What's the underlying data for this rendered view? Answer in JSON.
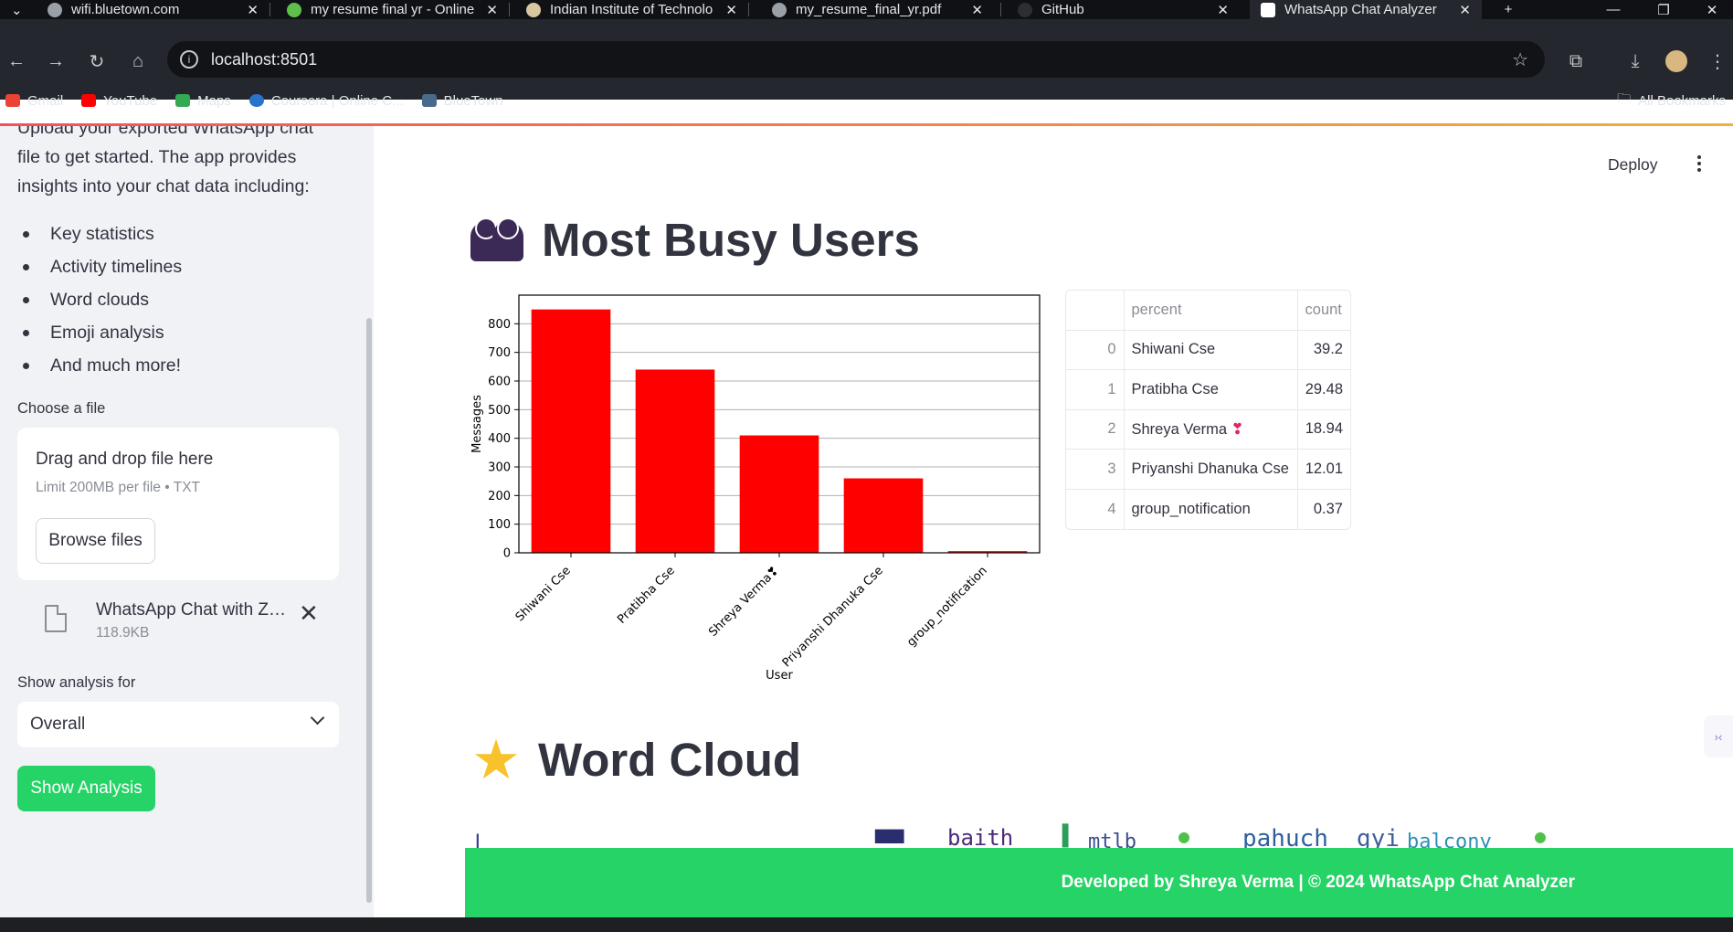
{
  "browser": {
    "tabs": [
      {
        "title": "wifi.bluetown.com",
        "active": false
      },
      {
        "title": "my resume final yr - Online",
        "active": false
      },
      {
        "title": "Indian Institute of Technolo",
        "active": false
      },
      {
        "title": "my_resume_final_yr.pdf",
        "active": false
      },
      {
        "title": "GitHub",
        "active": false
      },
      {
        "title": "WhatsApp Chat Analyzer",
        "active": true
      }
    ],
    "url": "localhost:8501",
    "bookmarks": [
      "Gmail",
      "YouTube",
      "Maps",
      "Coursera | Online C...",
      "BlueTown"
    ],
    "all_bookmarks": "All Bookmarks"
  },
  "sidebar": {
    "intro": "Upload your exported WhatsApp chat file to get started. The app provides insights into your chat data including:",
    "features": [
      "Key statistics",
      "Activity timelines",
      "Word clouds",
      "Emoji analysis",
      "And much more!"
    ],
    "file_label": "Choose a file",
    "dropzone_title": "Drag and drop file here",
    "dropzone_limit": "Limit 200MB per file • TXT",
    "browse_label": "Browse files",
    "uploaded_file_name": "WhatsApp Chat with Zo...",
    "uploaded_file_size": "118.9KB",
    "analysis_label": "Show analysis for",
    "analysis_selected": "Overall",
    "show_button": "Show Analysis"
  },
  "header": {
    "deploy": "Deploy"
  },
  "sections": {
    "busy_users_title": "Most Busy Users",
    "word_cloud_title": "Word Cloud"
  },
  "chart_data": {
    "type": "bar",
    "categories": [
      "Shiwani Cse",
      "Pratibha Cse",
      "Shreya Verma❣",
      "Priyanshi Dhanuka Cse",
      "group_notification"
    ],
    "values": [
      850,
      640,
      410,
      260,
      6
    ],
    "xlabel": "User",
    "ylabel": "Messages",
    "ylim": [
      0,
      900
    ],
    "yticks": [
      0,
      100,
      200,
      300,
      400,
      500,
      600,
      700,
      800
    ],
    "bar_color": "#ff0000",
    "grid": true
  },
  "table": {
    "columns": [
      "",
      "percent",
      "count"
    ],
    "rows": [
      {
        "index": "0",
        "name": "Shiwani Cse",
        "value": "39.2"
      },
      {
        "index": "1",
        "name": "Pratibha Cse",
        "value": "29.48"
      },
      {
        "index": "2",
        "name": "Shreya Verma",
        "heart": "❣",
        "value": "18.94"
      },
      {
        "index": "3",
        "name": "Priyanshi Dhanuka Cse",
        "value": "12.01"
      },
      {
        "index": "4",
        "name": "group_notification",
        "value": "0.37"
      }
    ]
  },
  "word_cloud_words": [
    "baith",
    "mtlb",
    "pahuch",
    "gyi",
    "balcony"
  ],
  "footer": "Developed by Shreya Verma | © 2024 WhatsApp Chat Analyzer",
  "colors": {
    "accent_green": "#25d366",
    "sidebar_bg": "#f0f2f6",
    "text_dark": "#31333f",
    "bar_red": "#ff0000"
  }
}
